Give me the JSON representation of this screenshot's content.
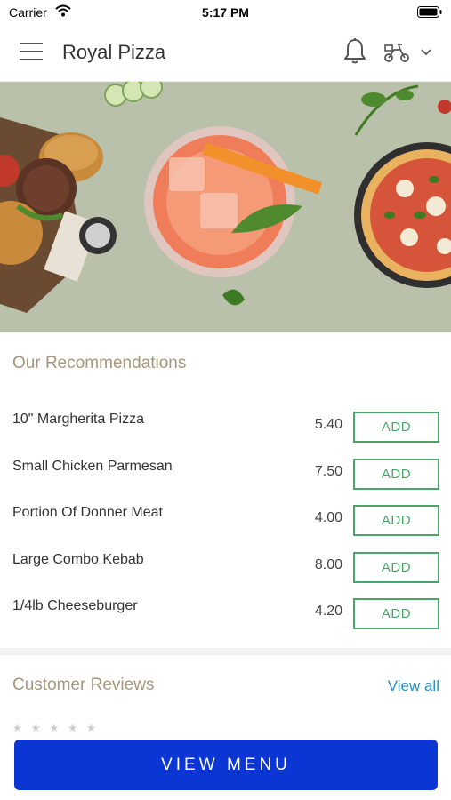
{
  "status_bar": {
    "carrier": "Carrier",
    "time": "5:17 PM",
    "wifi_icon": "wifi-icon",
    "battery_icon": "battery-icon"
  },
  "header": {
    "title": "Royal Pizza",
    "menu_icon": "menu-icon",
    "bell_icon": "bell-icon",
    "delivery_icon": "scooter-icon",
    "dropdown_icon": "chevron-down-icon"
  },
  "recommendations": {
    "title": "Our Recommendations",
    "items": [
      {
        "name": "10\" Margherita Pizza",
        "price": "5.40",
        "action": "ADD"
      },
      {
        "name": "Small Chicken Parmesan",
        "price": "7.50",
        "action": "ADD"
      },
      {
        "name": "Portion Of Donner Meat",
        "price": "4.00",
        "action": "ADD"
      },
      {
        "name": "Large Combo Kebab",
        "price": "8.00",
        "action": "ADD"
      },
      {
        "name": "1/4lb Cheeseburger",
        "price": "4.20",
        "action": "ADD"
      }
    ]
  },
  "reviews": {
    "title": "Customer Reviews",
    "view_all": "View all"
  },
  "footer": {
    "view_menu": "VIEW MENU"
  },
  "colors": {
    "accent_gold": "#a8977a",
    "add_green": "#4aa56b",
    "link_blue": "#2e8fbd",
    "primary_blue": "#0b36d4"
  }
}
